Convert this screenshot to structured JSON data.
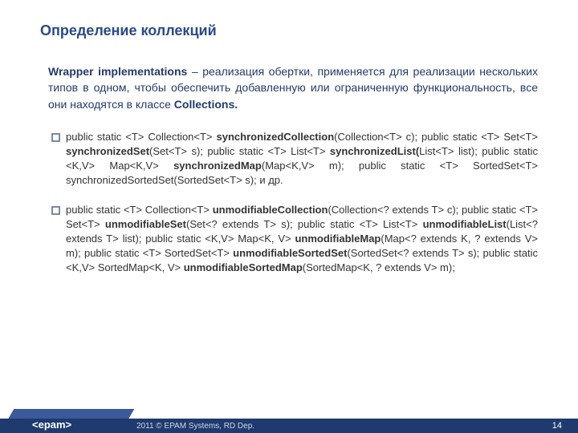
{
  "title": "Определение коллекций",
  "intro": {
    "lead_bold": "Wrapper implementations",
    "rest": " – реализация обертки, применяется для реализации нескольких типов в одном, чтобы обеспечить добавленную или ограниченную функциональность, все они находятся в классе ",
    "tail_bold": "Collections."
  },
  "bullets": [
    {
      "segments": [
        {
          "t": "public static <T> Collection<T> ",
          "b": false
        },
        {
          "t": "synchronizedCollection",
          "b": true
        },
        {
          "t": "(Collection<T> c); public static <T> Set<T> ",
          "b": false
        },
        {
          "t": "synchronizedSet",
          "b": true
        },
        {
          "t": "(Set<T> s); public static <T> List<T> ",
          "b": false
        },
        {
          "t": "synchronizedList(",
          "b": true
        },
        {
          "t": "List<T> list); public static <K,V> Map<K,V> ",
          "b": false
        },
        {
          "t": "synchronizedMap",
          "b": true
        },
        {
          "t": "(Map<K,V> m); public static <T> SortedSet<T> synchronizedSortedSet(SortedSet<T> s); и др.",
          "b": false
        }
      ]
    },
    {
      "segments": [
        {
          "t": "public static <T> Collection<T> ",
          "b": false
        },
        {
          "t": "unmodifiableCollection",
          "b": true
        },
        {
          "t": "(Collection<? extends T> c); public static <T> Set<T> ",
          "b": false
        },
        {
          "t": "unmodifiableSet",
          "b": true
        },
        {
          "t": "(Set<? extends T> s); public static <T> List<T> ",
          "b": false
        },
        {
          "t": "unmodifiableList",
          "b": true
        },
        {
          "t": "(List<? extends T> list); public static <K,V> Map<K, V> ",
          "b": false
        },
        {
          "t": "unmodifiableMap",
          "b": true
        },
        {
          "t": "(Map<? extends K, ? extends V> m); public static <T> SortedSet<T> ",
          "b": false
        },
        {
          "t": "unmodifiableSortedSet",
          "b": true
        },
        {
          "t": "(SortedSet<? extends T> s); public static <K,V> SortedMap<K, V> ",
          "b": false
        },
        {
          "t": "unmodifiableSortedMap",
          "b": true
        },
        {
          "t": "(SortedMap<K, ? extends V> m);",
          "b": false
        }
      ]
    }
  ],
  "footer": {
    "logo": "<epam>",
    "copyright": "2011 © EPAM Systems, RD Dep.",
    "page": "14"
  }
}
